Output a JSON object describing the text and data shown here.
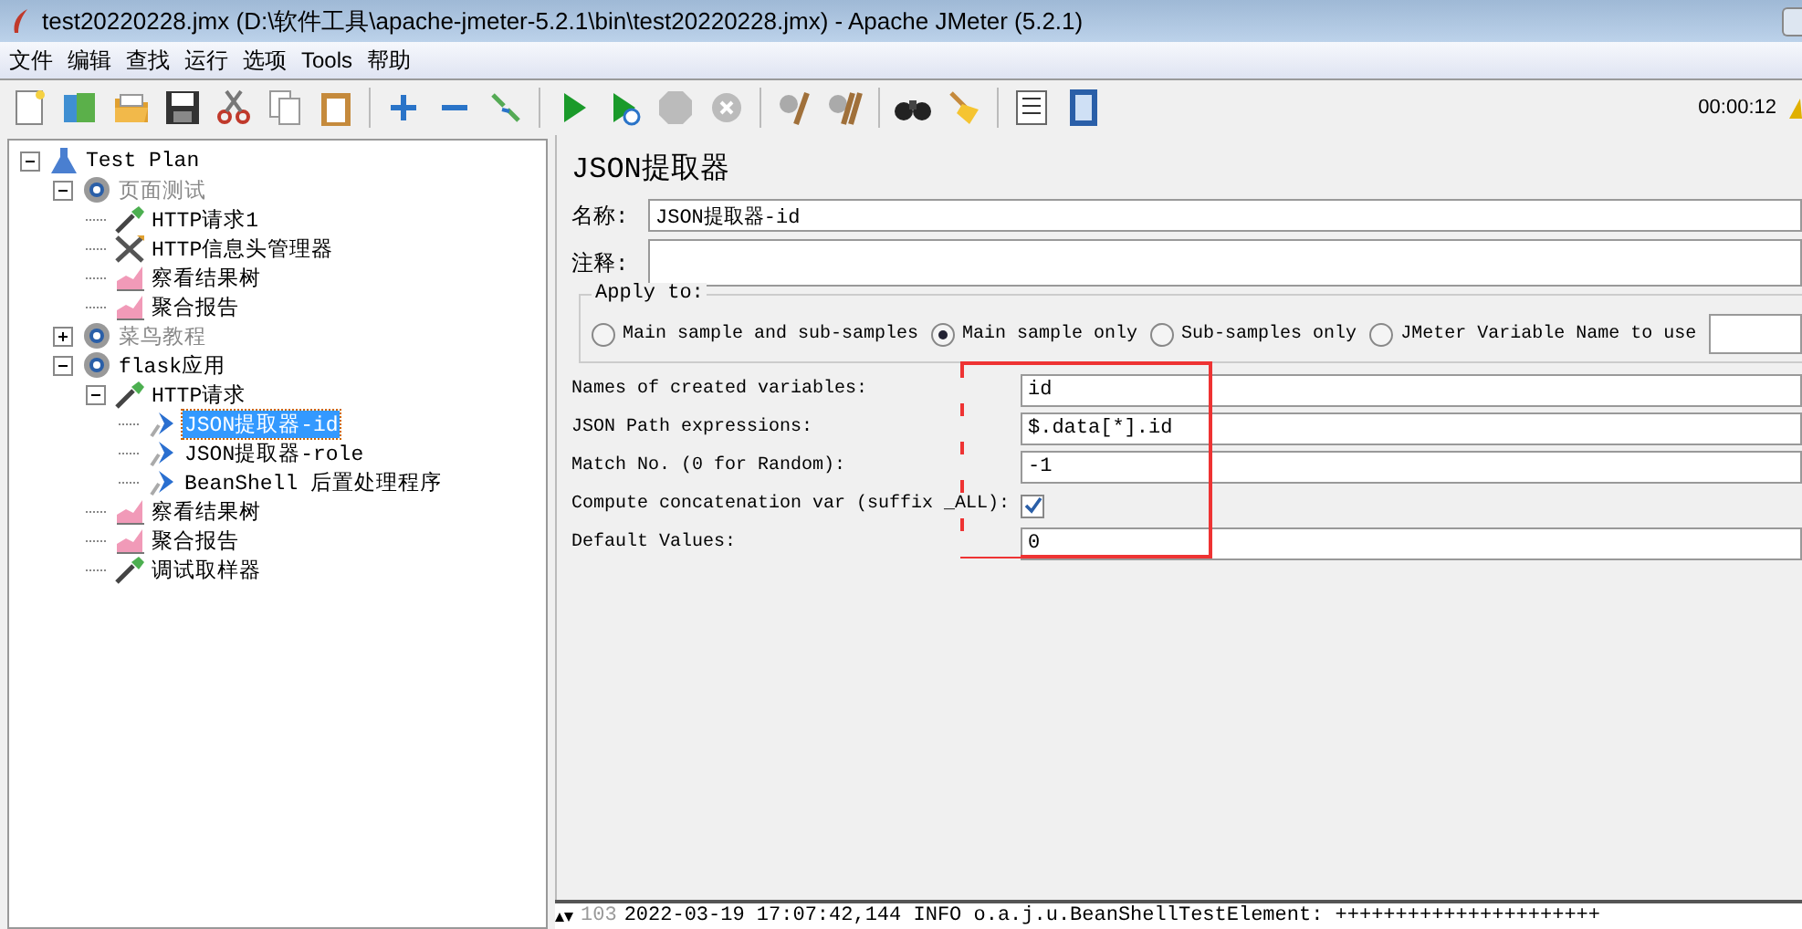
{
  "window": {
    "title": "test20220228.jmx (D:\\软件工具\\apache-jmeter-5.2.1\\bin\\test20220228.jmx) - Apache JMeter (5.2.1)"
  },
  "menu": [
    "文件",
    "编辑",
    "查找",
    "运行",
    "选项",
    "Tools",
    "帮助"
  ],
  "timer": "00:00:12",
  "tree": [
    {
      "label": "Test Plan",
      "kind": "testplan",
      "expanded": true,
      "disabled": false,
      "selected": false,
      "children": [
        {
          "label": "页面测试",
          "kind": "threadgroup",
          "expanded": true,
          "disabled": true,
          "selected": false,
          "children": [
            {
              "label": "HTTP请求1",
              "kind": "sampler",
              "disabled": false,
              "selected": false
            },
            {
              "label": "HTTP信息头管理器",
              "kind": "config",
              "disabled": false,
              "selected": false
            },
            {
              "label": "察看结果树",
              "kind": "listener",
              "disabled": false,
              "selected": false
            },
            {
              "label": "聚合报告",
              "kind": "listener",
              "disabled": false,
              "selected": false
            }
          ]
        },
        {
          "label": "菜鸟教程",
          "kind": "threadgroup",
          "expanded": false,
          "disabled": true,
          "selected": false
        },
        {
          "label": "flask应用",
          "kind": "threadgroup",
          "expanded": true,
          "disabled": false,
          "selected": false,
          "children": [
            {
              "label": "HTTP请求",
              "kind": "sampler",
              "expanded": true,
              "disabled": false,
              "selected": false,
              "children": [
                {
                  "label": "JSON提取器-id",
                  "kind": "postprocessor",
                  "disabled": false,
                  "selected": true
                },
                {
                  "label": "JSON提取器-role",
                  "kind": "postprocessor",
                  "disabled": false,
                  "selected": false
                },
                {
                  "label": "BeanShell 后置处理程序",
                  "kind": "postprocessor",
                  "disabled": false,
                  "selected": false
                }
              ]
            },
            {
              "label": "察看结果树",
              "kind": "listener",
              "disabled": false,
              "selected": false
            },
            {
              "label": "聚合报告",
              "kind": "listener",
              "disabled": false,
              "selected": false
            },
            {
              "label": "调试取样器",
              "kind": "sampler",
              "disabled": false,
              "selected": false
            }
          ]
        }
      ]
    }
  ],
  "panel": {
    "title": "JSON提取器",
    "name_label": "名称:",
    "name_value": "JSON提取器-id",
    "comment_label": "注释:",
    "apply_to": {
      "legend": "Apply to:",
      "options": [
        {
          "label": "Main sample and sub-samples",
          "selected": false
        },
        {
          "label": "Main sample only",
          "selected": true
        },
        {
          "label": "Sub-samples only",
          "selected": false
        },
        {
          "label": "JMeter Variable Name to use",
          "selected": false
        }
      ]
    },
    "fields": [
      {
        "kind": "text",
        "label": "Names of created variables:",
        "value": "id"
      },
      {
        "kind": "text",
        "label": "JSON Path expressions:",
        "value": "$.data[*].id"
      },
      {
        "kind": "text",
        "label": "Match No. (0 for Random):",
        "value": "-1"
      },
      {
        "kind": "checkbox",
        "label": "Compute concatenation var (suffix _ALL):",
        "checked": true
      },
      {
        "kind": "text",
        "label": "Default Values:",
        "value": "0"
      }
    ]
  },
  "log": {
    "line_number": "103",
    "text": "2022-03-19 17:07:42,144 INFO o.a.j.u.BeanShellTestElement: ++++++++++++++++++++++"
  }
}
